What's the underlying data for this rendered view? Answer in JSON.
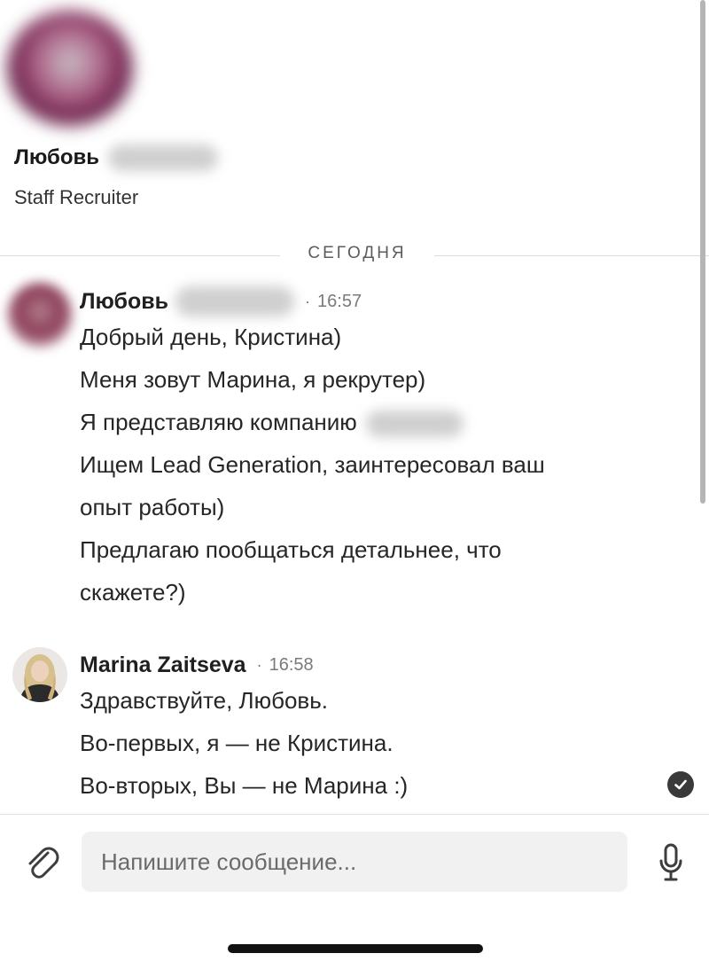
{
  "profile": {
    "name": "Любовь",
    "role": "Staff Recruiter"
  },
  "date_divider": "СЕГОДНЯ",
  "messages": [
    {
      "sender": "Любовь",
      "separator": "·",
      "time": "16:57",
      "lines": [
        "Добрый день, Кристина)",
        "Меня зовут Марина, я рекрутер)",
        "Я представляю компанию",
        "Ищем Lead Generation, заинтересовал ваш",
        "опыт работы)",
        "Предлагаю пообщаться детальнее, что",
        "скажете?)"
      ]
    },
    {
      "sender": "Marina Zaitseva",
      "separator": "·",
      "time": "16:58",
      "lines": [
        "Здравствуйте, Любовь.",
        "Во-первых, я — не Кристина.",
        "Во-вторых, Вы — не Марина :)"
      ]
    }
  ],
  "composer": {
    "placeholder": "Напишите сообщение..."
  },
  "icons": {
    "attach": "paperclip-icon",
    "mic": "microphone-icon",
    "read": "read-receipt-check-icon"
  }
}
